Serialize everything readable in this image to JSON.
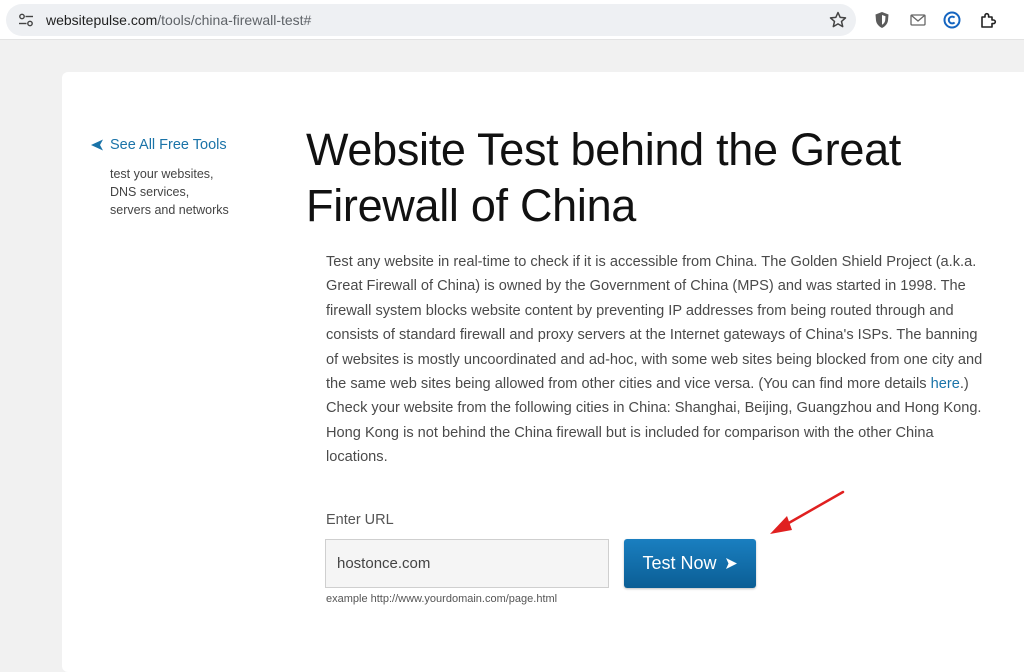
{
  "browser": {
    "url_host": "websitepulse.com",
    "url_path": "/tools/china-firewall-test#"
  },
  "sidebar": {
    "back_link_label": "See All Free Tools",
    "description_lines": [
      "test your websites,",
      "DNS services,",
      "servers and networks"
    ]
  },
  "main": {
    "title": "Website Test behind the Great Firewall of China",
    "paragraph1_before_link": "Test any website in real-time to check if it is accessible from China. The Golden Shield Project (a.k.a. Great Firewall of China) is owned by the Government of China (MPS) and was started in 1998. The firewall system blocks website content by preventing IP addresses from being routed through and consists of standard firewall and proxy servers at the Internet gateways of China's ISPs. The banning of websites is mostly uncoordinated and ad-hoc, with some web sites being blocked from one city and the same web sites being allowed from other cities and vice versa. (You can find more details ",
    "paragraph1_link": "here",
    "paragraph1_after_link": ".)",
    "paragraph2": "Check your website from the following cities in China: Shanghai, Beijing, Guangzhou and Hong Kong. Hong Kong is not behind the China firewall but is included for comparison with the other China locations."
  },
  "form": {
    "label": "Enter URL",
    "url_value": "hostonce.com",
    "button_label": "Test Now",
    "example": "example http://www.yourdomain.com/page.html"
  },
  "colors": {
    "accent": "#1a73a8",
    "button": "#0b6aa8",
    "annotation": "#e02020"
  }
}
